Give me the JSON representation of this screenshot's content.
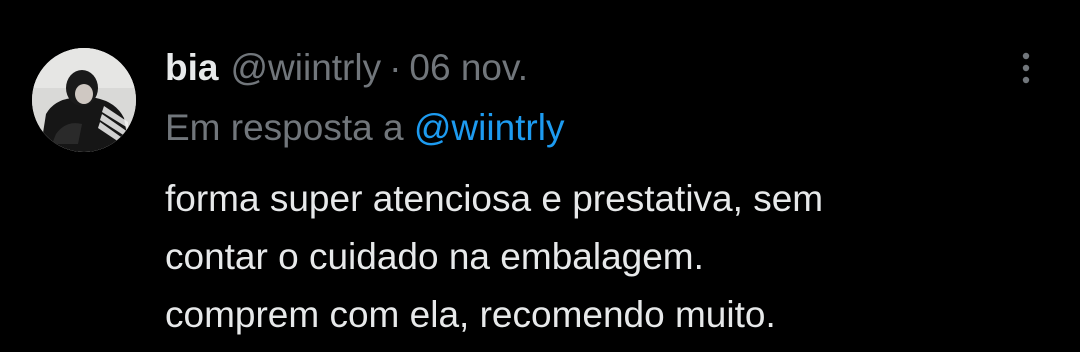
{
  "tweet": {
    "author": {
      "display_name": "bia",
      "handle": "@wiintrly"
    },
    "separator": "·",
    "date": "06 nov.",
    "reply_prefix": "Em resposta a",
    "reply_to": "@wiintrly",
    "text_lines": [
      "forma super atenciosa e prestativa, sem",
      "contar o cuidado na embalagem.",
      "comprem com ela, recomendo muito."
    ]
  },
  "icons": {
    "more": "more-vertical-icon"
  },
  "colors": {
    "background": "#000000",
    "primary_text": "#e7e9ea",
    "secondary_text": "#71767b",
    "link": "#1d9bf0"
  }
}
